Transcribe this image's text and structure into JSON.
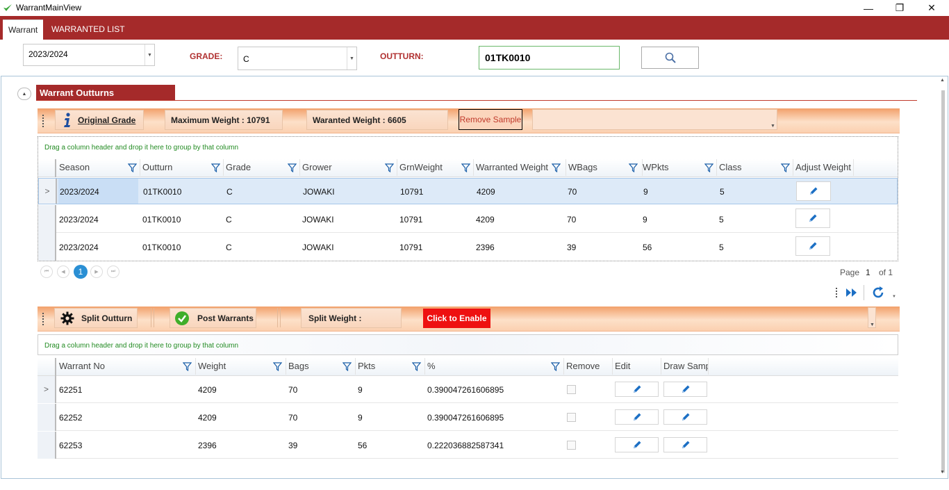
{
  "window": {
    "title": "WarrantMainView",
    "minimize": "—",
    "restore": "❐",
    "close": "✕"
  },
  "tabs": [
    {
      "label": "Warrant"
    },
    {
      "label": "WARRANTED  LIST"
    }
  ],
  "filters": {
    "season_value": "2023/2024",
    "grade_label": "GRADE:",
    "grade_value": "C",
    "outturn_label": "OUTTURN:",
    "outturn_value": "01TK0010"
  },
  "section": {
    "title": "Warrant Outturns"
  },
  "outturn_toolbar": {
    "original_grade": "Original Grade",
    "max_weight": "Maximum Weight :   10791",
    "warranted_weight": "Waranted Weight :   6605",
    "remove_sample": "Remove Sample"
  },
  "group_hint": "Drag a column header and drop it here to group by that column",
  "outturn_grid": {
    "columns": [
      "Season",
      "Outturn",
      "Grade",
      "Grower",
      "GrnWeight",
      "Warranted Weight",
      "WBags",
      "WPkts",
      "Class",
      "Adjust Weight"
    ],
    "rows": [
      [
        "2023/2024",
        "01TK0010",
        "C",
        "JOWAKI",
        "10791",
        "4209",
        "70",
        "9",
        "5"
      ],
      [
        "2023/2024",
        "01TK0010",
        "C",
        "JOWAKI",
        "10791",
        "4209",
        "70",
        "9",
        "5"
      ],
      [
        "2023/2024",
        "01TK0010",
        "C",
        "JOWAKI",
        "10791",
        "2396",
        "39",
        "56",
        "5"
      ]
    ]
  },
  "pager": {
    "current": "1",
    "page_label": "Page",
    "page_num": "1",
    "of_label": "of 1"
  },
  "split_toolbar": {
    "split_outturn": "Split Outturn",
    "post_warrants": "Post Warrants",
    "split_weight": "Split Weight :",
    "click_to_enable": "Click to Enable"
  },
  "warrant_grid": {
    "columns": [
      "Warrant No",
      "Weight",
      "Bags",
      "Pkts",
      "%",
      "Remove",
      "Edit",
      "Draw Samp"
    ],
    "rows": [
      [
        "62251",
        "4209",
        "70",
        "9",
        "0.390047261606895"
      ],
      [
        "62252",
        "4209",
        "70",
        "9",
        "0.390047261606895"
      ],
      [
        "62253",
        "2396",
        "39",
        "56",
        "0.222036882587341"
      ]
    ]
  },
  "colors": {
    "brand": "#a52a2a",
    "accent_blue": "#2a8fd4",
    "enable_red": "#ee1111"
  }
}
